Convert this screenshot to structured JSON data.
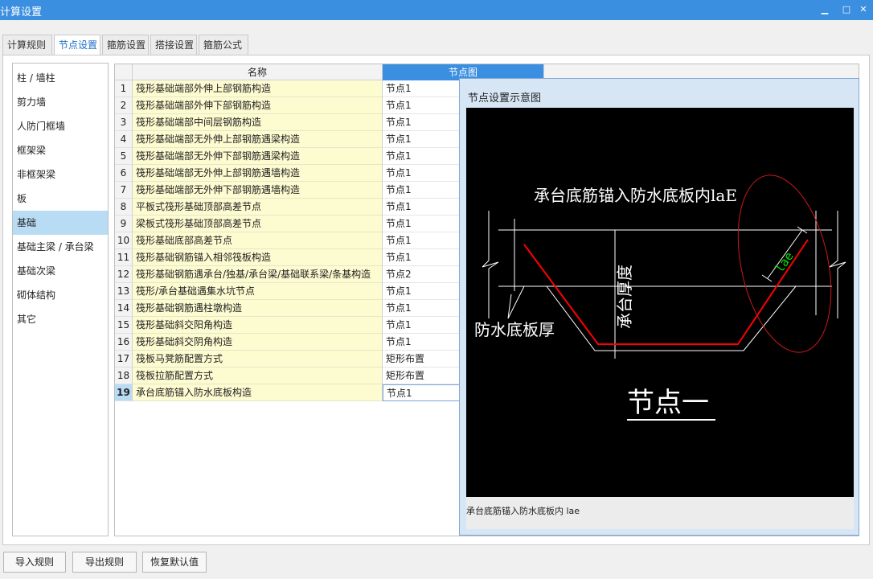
{
  "window": {
    "title": "计算设置",
    "minimize_icon": "minimize-icon",
    "maximize_icon": "maximize-icon",
    "close_icon": "close-icon"
  },
  "tabs": [
    {
      "label": "计算规则",
      "active": false
    },
    {
      "label": "节点设置",
      "active": true
    },
    {
      "label": "箍筋设置",
      "active": false
    },
    {
      "label": "搭接设置",
      "active": false
    },
    {
      "label": "箍筋公式",
      "active": false
    }
  ],
  "sidebar": {
    "items": [
      {
        "label": "柱 / 墙柱"
      },
      {
        "label": "剪力墙"
      },
      {
        "label": "人防门框墙"
      },
      {
        "label": "框架梁"
      },
      {
        "label": "非框架梁"
      },
      {
        "label": "板"
      },
      {
        "label": "基础",
        "active": true
      },
      {
        "label": "基础主梁 / 承台梁"
      },
      {
        "label": "基础次梁"
      },
      {
        "label": "砌体结构"
      },
      {
        "label": "其它"
      }
    ]
  },
  "grid": {
    "columns": {
      "name": "名称",
      "diagram": "节点图"
    },
    "rows": [
      {
        "num": "1",
        "name": "筏形基础端部外伸上部钢筋构造",
        "value": "节点1"
      },
      {
        "num": "2",
        "name": "筏形基础端部外伸下部钢筋构造",
        "value": "节点1"
      },
      {
        "num": "3",
        "name": "筏形基础端部中间层钢筋构造",
        "value": "节点1"
      },
      {
        "num": "4",
        "name": "筏形基础端部无外伸上部钢筋遇梁构造",
        "value": "节点1"
      },
      {
        "num": "5",
        "name": "筏形基础端部无外伸下部钢筋遇梁构造",
        "value": "节点1"
      },
      {
        "num": "6",
        "name": "筏形基础端部无外伸上部钢筋遇墙构造",
        "value": "节点1"
      },
      {
        "num": "7",
        "name": "筏形基础端部无外伸下部钢筋遇墙构造",
        "value": "节点1"
      },
      {
        "num": "8",
        "name": "平板式筏形基础顶部高差节点",
        "value": "节点1"
      },
      {
        "num": "9",
        "name": "梁板式筏形基础顶部高差节点",
        "value": "节点1"
      },
      {
        "num": "10",
        "name": "筏形基础底部高差节点",
        "value": "节点1"
      },
      {
        "num": "11",
        "name": "筏形基础钢筋锚入相邻筏板构造",
        "value": "节点1"
      },
      {
        "num": "12",
        "name": "筏形基础钢筋遇承台/独基/承台梁/基础联系梁/条基构造",
        "value": "节点2"
      },
      {
        "num": "13",
        "name": "筏形/承台基础遇集水坑节点",
        "value": "节点1"
      },
      {
        "num": "14",
        "name": "筏形基础钢筋遇柱墩构造",
        "value": "节点1"
      },
      {
        "num": "15",
        "name": "筏形基础斜交阳角构造",
        "value": "节点1"
      },
      {
        "num": "16",
        "name": "筏形基础斜交阴角构造",
        "value": "节点1"
      },
      {
        "num": "17",
        "name": "筏板马凳筋配置方式",
        "value": "矩形布置"
      },
      {
        "num": "18",
        "name": "筏板拉筋配置方式",
        "value": "矩形布置"
      },
      {
        "num": "19",
        "name": "承台底筋锚入防水底板构造",
        "value": "节点1",
        "active": true
      }
    ]
  },
  "popup": {
    "title": "节点设置示意图",
    "diagram": {
      "top_label": "承台底筋锚入防水底板内laE",
      "vertical_label": "承台厚度",
      "left_label": "防水底板厚",
      "bar_label": "lae",
      "node_title": "节点一",
      "colors": {
        "bar": "#ff0000",
        "ellipse": "#d01818",
        "dim_text": "#00e000",
        "lines": "#ffffff"
      }
    },
    "caption": "承台底筋锚入防水底板内 lae"
  },
  "buttons": {
    "import": "导入规则",
    "export": "导出规则",
    "restore": "恢复默认值"
  }
}
